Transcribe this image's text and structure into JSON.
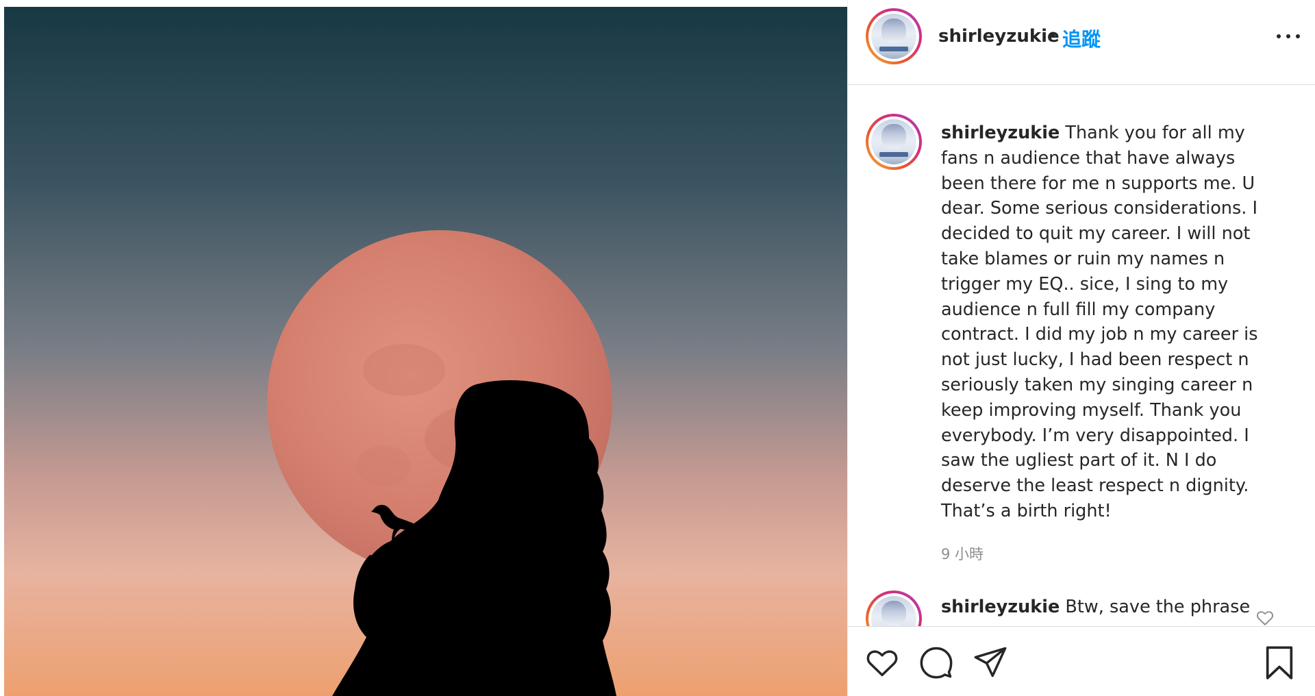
{
  "post": {
    "image_alt": "Silhouette of a girl with a small bird on her shoulder in front of a red full moon",
    "colors": {
      "sky_top": "#1c3a47",
      "sky_mid": "#5a6a78",
      "sky_low": "#c89088",
      "horizon": "#e8a070",
      "moon": "#d88778",
      "silhouette": "#000000"
    }
  },
  "header": {
    "username": "shirleyzukie",
    "separator": "•",
    "follow_label": "追蹤",
    "more_icon": "more-horizontal-icon"
  },
  "caption": {
    "username": "shirleyzukie",
    "text": "Thank you for all my fans n audience that have always been there for me n supports me. U dear. Some serious considerations. I decided to quit my career. I will not take blames or ruin my names n trigger my EQ.. sice, I sing to my audience n full fill my company contract. I did my job n my career is not just lucky, I had been respect n seriously taken my singing career n keep improving myself. Thank you everybody. I’m very disappointed. I saw the ugliest part of it. N I do deserve the least respect n dignity. That’s a birth right!",
    "time": "9 小時"
  },
  "comments": [
    {
      "username": "shirleyzukie",
      "text": "Btw, save the phrase"
    }
  ],
  "actions": {
    "like_icon": "heart-icon",
    "comment_icon": "comment-icon",
    "share_icon": "share-icon",
    "save_icon": "bookmark-icon"
  }
}
